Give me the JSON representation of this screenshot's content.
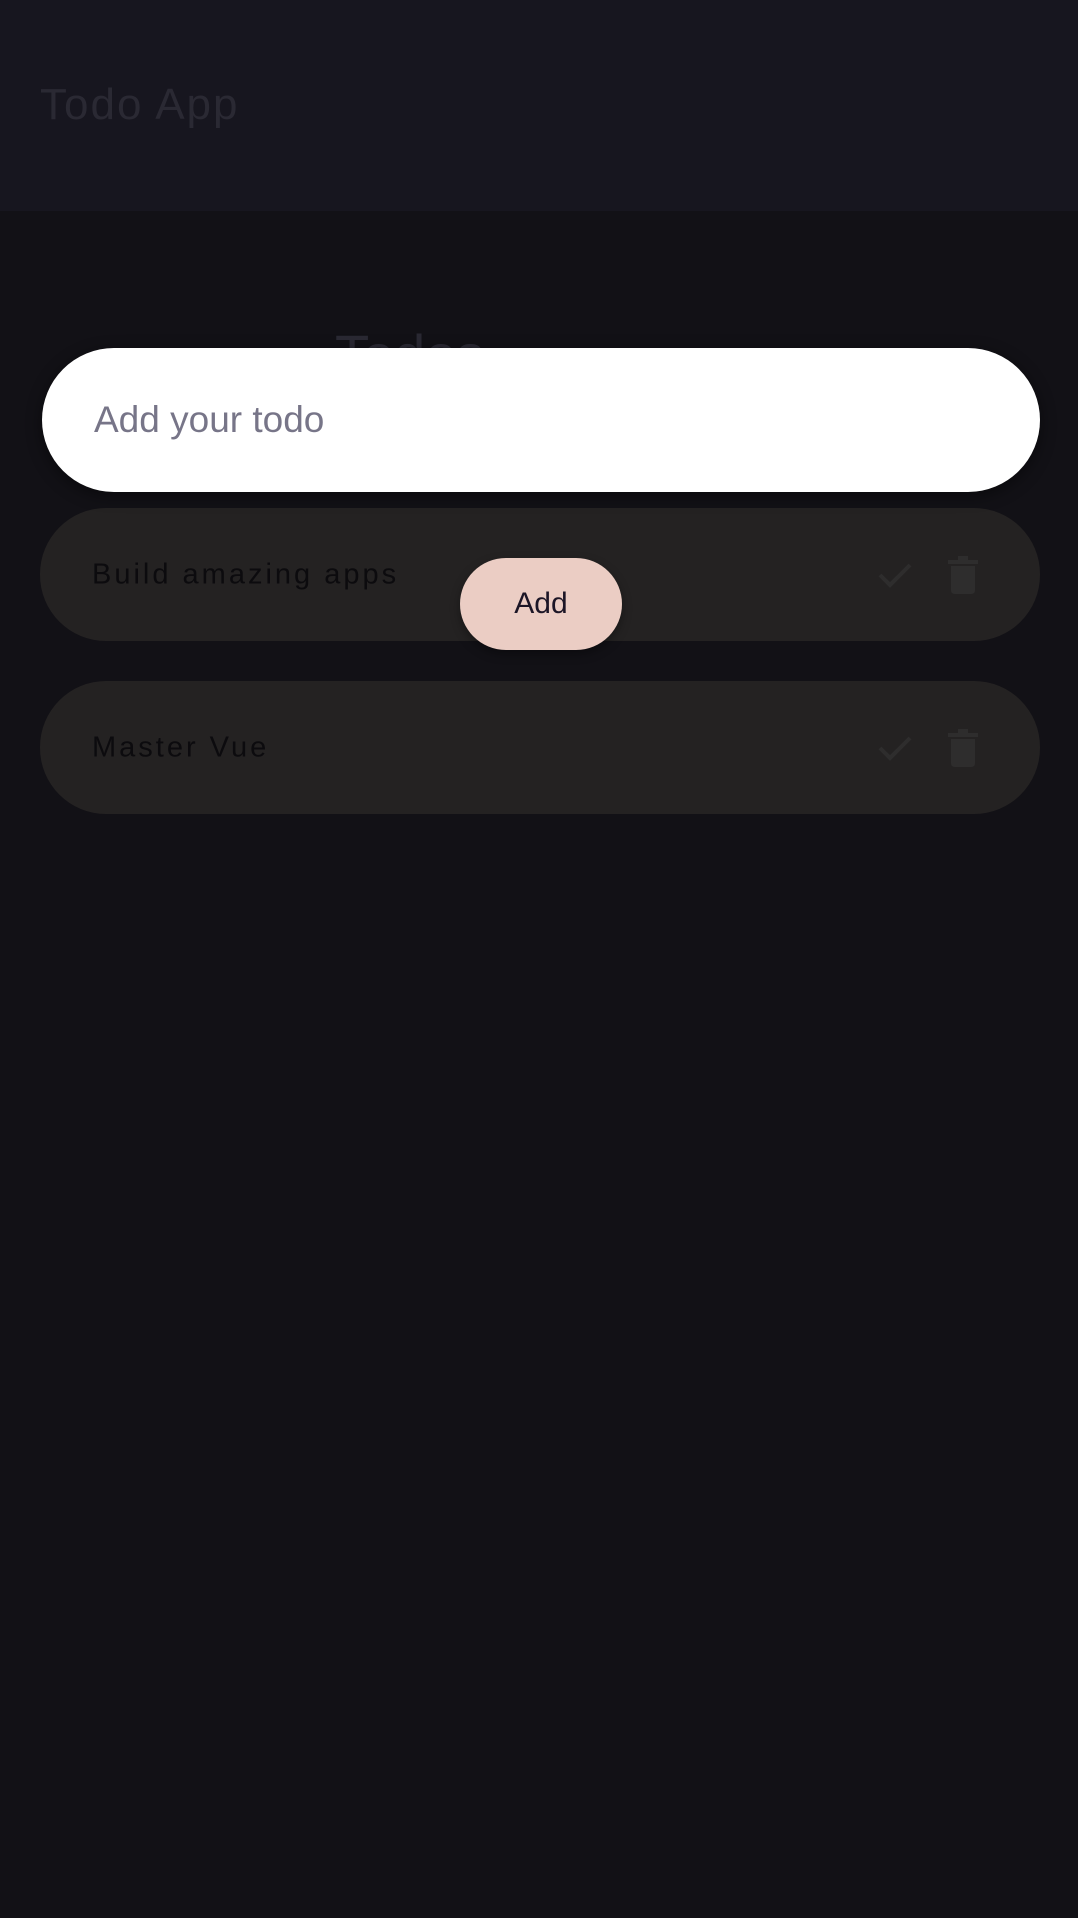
{
  "app": {
    "title": "Todo App"
  },
  "section": {
    "title": "Todos"
  },
  "input": {
    "value": "",
    "placeholder": "Add your todo"
  },
  "add_button": {
    "label": "Add"
  },
  "todos": [
    {
      "text": "Build amazing apps",
      "icons": [
        "check-icon",
        "trash-icon"
      ]
    },
    {
      "text": "Master Vue",
      "icons": [
        "check-icon",
        "trash-icon"
      ]
    }
  ],
  "colors": {
    "background": "#121116",
    "topbar": "#17161f",
    "todo_item": "#242222",
    "input_background": "#ffffff",
    "add_button": "#ebcdc4",
    "icon_dim": "#2e2d2d"
  }
}
